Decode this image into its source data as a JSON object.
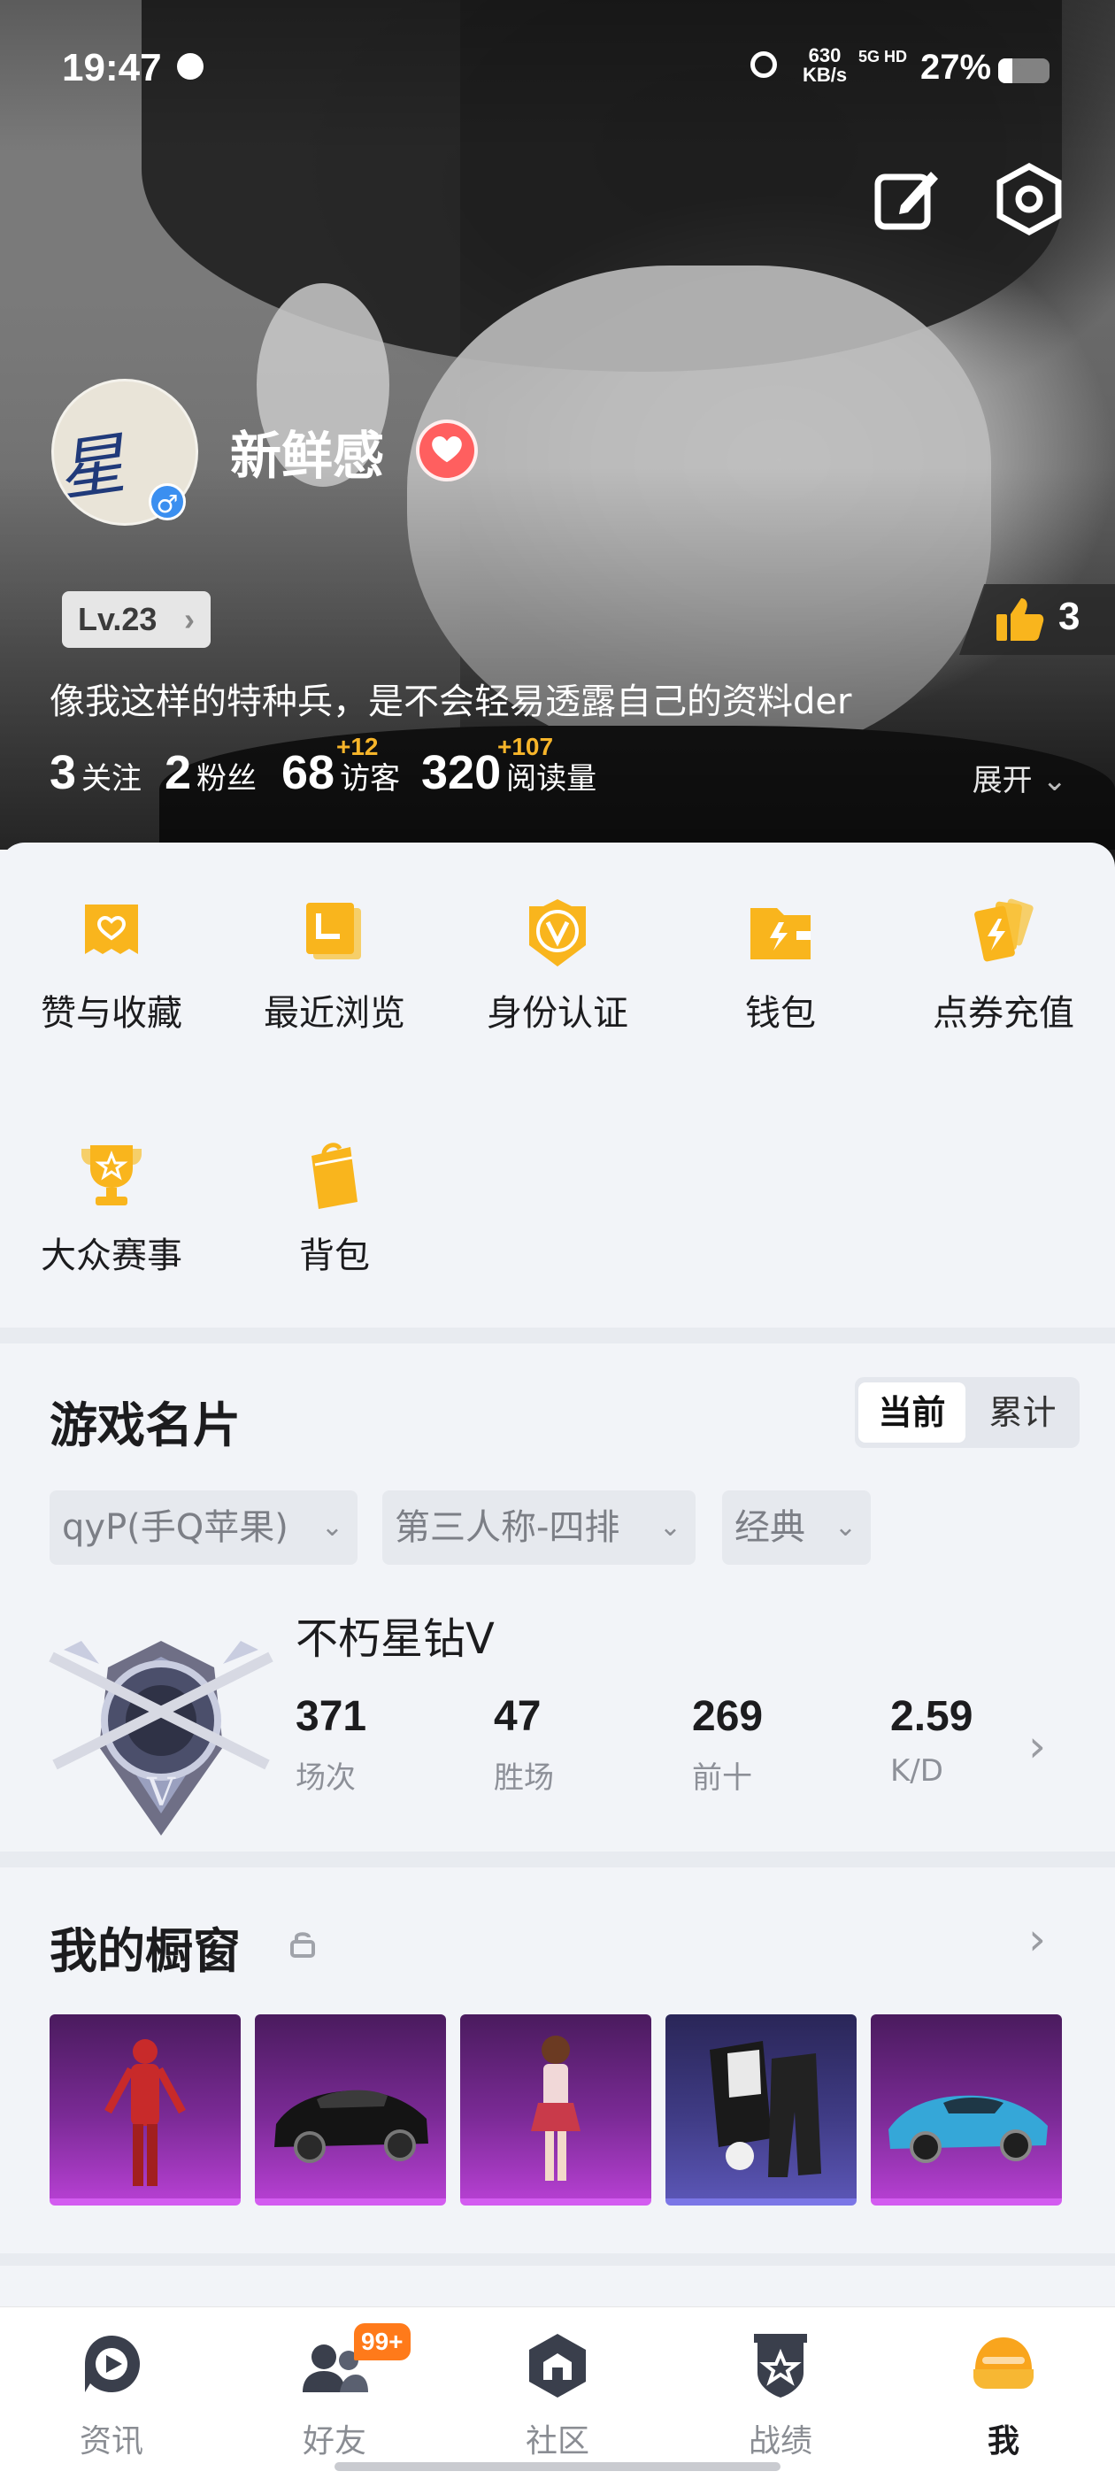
{
  "status_bar": {
    "time": "19:47",
    "net_speed": "630",
    "net_speed_unit": "KB/s",
    "network": "5G HD",
    "battery_percent": "27%",
    "battery_level": 0.27
  },
  "profile": {
    "avatar_text": "星仔",
    "gender_symbol": "♂",
    "nickname": "新鲜感",
    "level": "Lv.23",
    "likes": "3",
    "bio": "像我这样的特种兵，是不会轻易透露自己的资料der",
    "stats": [
      {
        "num": "3",
        "label": "关注",
        "plus": ""
      },
      {
        "num": "2",
        "label": "粉丝",
        "plus": ""
      },
      {
        "num": "68",
        "label": "访客",
        "plus": "+12"
      },
      {
        "num": "320",
        "label": "阅读量",
        "plus": "+107"
      }
    ],
    "expand_label": "展开"
  },
  "menu": [
    {
      "label": "赞与收藏",
      "icon": "heart-folder-icon"
    },
    {
      "label": "最近浏览",
      "icon": "history-icon"
    },
    {
      "label": "身份认证",
      "icon": "verify-badge-icon"
    },
    {
      "label": "钱包",
      "icon": "wallet-icon"
    },
    {
      "label": "点券充值",
      "icon": "coupon-cards-icon"
    },
    {
      "label": "大众赛事",
      "icon": "trophy-icon"
    },
    {
      "label": "背包",
      "icon": "backpack-icon"
    }
  ],
  "game_card": {
    "title": "游戏名片",
    "toggle": [
      "当前",
      "累计"
    ],
    "filters": [
      "qyP(手Q苹果)",
      "第三人称-四排",
      "经典"
    ],
    "rank": "不朽星钻Ⅴ",
    "stats": [
      {
        "value": "371",
        "label": "场次"
      },
      {
        "value": "47",
        "label": "胜场"
      },
      {
        "value": "269",
        "label": "前十"
      },
      {
        "value": "2.59",
        "label": "K/D"
      }
    ]
  },
  "showcase": {
    "title": "我的橱窗"
  },
  "bottom_nav": [
    {
      "label": "资讯",
      "icon": "news-play-icon"
    },
    {
      "label": "好友",
      "icon": "friends-icon",
      "badge": "99+"
    },
    {
      "label": "社区",
      "icon": "community-icon"
    },
    {
      "label": "战绩",
      "icon": "record-shield-icon"
    },
    {
      "label": "我",
      "icon": "me-helmet-icon"
    }
  ],
  "colors": {
    "accent_yellow": "#f9b51d",
    "badge_orange": "#ff7a1a",
    "heart_red": "#ff5f5f",
    "showcase_purple": "#b43fd0"
  }
}
